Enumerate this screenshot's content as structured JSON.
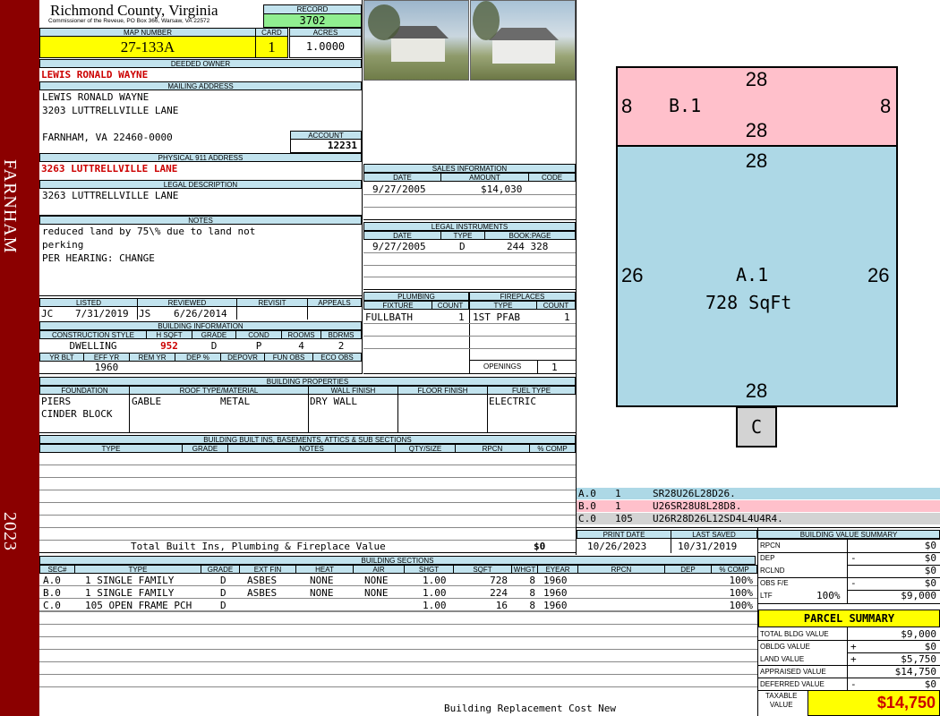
{
  "sidebar": {
    "town": "FARNHAM",
    "year": "2023"
  },
  "header": {
    "county": "Richmond County, Virginia",
    "commissioner": "Commissioner of the Reveue, PO Box 366, Warsaw, VA 22572",
    "record_label": "RECORD",
    "record": "3702",
    "map_label": "MAP NUMBER",
    "map_number": "27-133A",
    "card_label": "CARD",
    "card": "1",
    "acres_label": "ACRES",
    "acres": "1.0000"
  },
  "owner": {
    "deeded_label": "DEEDED OWNER",
    "deeded": "LEWIS RONALD WAYNE",
    "mailing_label": "MAILING ADDRESS",
    "mail1": "LEWIS RONALD WAYNE",
    "mail2": "3203 LUTTRELLVILLE LANE",
    "mail3": "FARNHAM, VA 22460-0000",
    "account_label": "ACCOUNT",
    "account": "12231",
    "physical_label": "PHYSICAL 911 ADDRESS",
    "physical": "3263 LUTTRELLVILLE LANE",
    "legal_label": "LEGAL DESCRIPTION",
    "legal": "3263 LUTTRELLVILLE LANE",
    "notes_label": "NOTES",
    "note1": "reduced land by 75\\% due to land not",
    "note2": "perking",
    "note3": "PER HEARING: CHANGE"
  },
  "review": {
    "listed_label": "LISTED",
    "reviewed_label": "REVIEWED",
    "revisit_label": "REVISIT",
    "appeals_label": "APPEALS",
    "listed_by": "JC",
    "listed_date": "7/31/2019",
    "reviewed_by": "JS",
    "reviewed_date": "6/26/2014"
  },
  "building_info": {
    "title": "BUILDING INFORMATION",
    "h_cs": "CONSTRUCTION STYLE",
    "h_hsqft": "H SQFT",
    "h_grade": "GRADE",
    "h_cond": "COND",
    "h_rooms": "ROOMS",
    "h_bdrms": "BDRMS",
    "cs": "DWELLING",
    "hsqft": "952",
    "grade": "D",
    "cond": "P",
    "rooms": "4",
    "bdrms": "2",
    "h_yrblt": "YR BLT",
    "h_effyr": "EFF YR",
    "h_remyr": "REM YR",
    "h_dep": "DEP %",
    "h_depovr": "DEPOVR",
    "h_funobs": "FUN OBS",
    "h_ecoobs": "ECO OBS",
    "effyr": "1960"
  },
  "sales": {
    "title": "SALES INFORMATION",
    "h_date": "DATE",
    "h_amount": "AMOUNT",
    "h_code": "CODE",
    "date": "9/27/2005",
    "amount": "$14,030"
  },
  "legal_inst": {
    "title": "LEGAL INSTRUMENTS",
    "h_date": "DATE",
    "h_type": "TYPE",
    "h_book": "BOOK:PAGE",
    "date": "9/27/2005",
    "type": "D",
    "book": "244 328"
  },
  "plumbing": {
    "title": "PLUMBING",
    "h_fixture": "FIXTURE",
    "h_count": "COUNT",
    "fixture": "FULLBATH",
    "count": "1"
  },
  "fireplaces": {
    "title": "FIREPLACES",
    "h_type": "TYPE",
    "h_count": "COUNT",
    "type": "1ST PFAB",
    "count": "1",
    "openings_label": "OPENINGS",
    "openings": "1"
  },
  "props": {
    "title": "BUILDING PROPERTIES",
    "h_found": "FOUNDATION",
    "h_roof": "ROOF TYPE/MATERIAL",
    "h_wall": "WALL FINISH",
    "h_floor": "FLOOR FINISH",
    "h_fuel": "FUEL TYPE",
    "found1": "PIERS",
    "found2": "CINDER BLOCK",
    "roof1": "GABLE",
    "roof2": "METAL",
    "wall": "DRY WALL",
    "fuel": "ELECTRIC"
  },
  "builtins": {
    "title": "BUILDING BUILT INS, BASEMENTS, ATTICS & SUB SECTIONS",
    "h_type": "TYPE",
    "h_grade": "GRADE",
    "h_notes": "NOTES",
    "h_qty": "QTY/SIZE",
    "h_rpcn": "RPCN",
    "h_comp": "% COMP",
    "total_label": "Total Built Ins, Plumbing & Fireplace Value",
    "total": "$0"
  },
  "sections": {
    "title": "BUILDING SECTIONS",
    "headers": [
      "SEC#",
      "TYPE",
      "GRADE",
      "EXT FIN",
      "HEAT",
      "AIR",
      "SHGT",
      "SQFT",
      "WHGT",
      "EYEAR",
      "RPCN",
      "DEP",
      "% COMP"
    ],
    "rows": [
      {
        "sec": "A.0",
        "type": "1 SINGLE FAMILY",
        "grade": "D",
        "ext": "ASBES",
        "heat": "NONE",
        "air": "NONE",
        "shgt": "1.00",
        "sqft": "728",
        "whgt": "8",
        "eyear": "1960",
        "comp": "100%"
      },
      {
        "sec": "B.0",
        "type": "1 SINGLE FAMILY",
        "grade": "D",
        "ext": "ASBES",
        "heat": "NONE",
        "air": "NONE",
        "shgt": "1.00",
        "sqft": "224",
        "whgt": "8",
        "eyear": "1960",
        "comp": "100%"
      },
      {
        "sec": "C.0",
        "type": "105 OPEN FRAME PCH",
        "grade": "D",
        "ext": "",
        "heat": "",
        "air": "",
        "shgt": "1.00",
        "sqft": "16",
        "whgt": "8",
        "eyear": "1960",
        "comp": "100%"
      }
    ],
    "footer": "Building Replacement Cost New"
  },
  "sketch": {
    "b_top": "28",
    "b_bottom": "28",
    "b_left": "8",
    "b_right": "8",
    "b_label": "B.1",
    "a_top": "28",
    "a_bottom": "28",
    "a_left": "26",
    "a_right": "26",
    "a_label": "A.1",
    "a_area": "728 SqFt",
    "c_label": "C",
    "colors": {
      "a": "#add8e6",
      "b": "#ffc0cb",
      "c": "#d3d3d3"
    }
  },
  "vectors": [
    {
      "sec": "A.0",
      "n": "1",
      "code": "SR28U26L28D26."
    },
    {
      "sec": "B.0",
      "n": "1",
      "code": "U26SR28U8L28D8."
    },
    {
      "sec": "C.0",
      "n": "105",
      "code": "U26R28D26L12SD4L4U4R4."
    }
  ],
  "dates": {
    "print_label": "PRINT DATE",
    "print": "10/26/2023",
    "saved_label": "LAST SAVED",
    "saved": "10/31/2019"
  },
  "value_summary": {
    "title": "BUILDING VALUE SUMMARY",
    "rpcn_label": "RPCN",
    "rpcn": "$0",
    "dep_label": "DEP",
    "dep_sign": "-",
    "dep": "$0",
    "rclnd_label": "RCLND",
    "rclnd": "$0",
    "obs_label": "OBS F/E",
    "obs_sign": "-",
    "obs": "$0",
    "ltf_label": "LTF",
    "ltf_pct": "100%",
    "ltf": "$9,000"
  },
  "parcel": {
    "title": "PARCEL SUMMARY",
    "total_label": "TOTAL BLDG VALUE",
    "total": "$9,000",
    "obldg_label": "OBLDG VALUE",
    "obldg_sign": "+",
    "obldg": "$0",
    "land_label": "LAND VALUE",
    "land_sign": "+",
    "land": "$5,750",
    "appr_label": "APPRAISED VALUE",
    "appr": "$14,750",
    "def_label": "DEFERRED VALUE",
    "def_sign": "-",
    "def": "$0",
    "taxable_label1": "TAXABLE",
    "taxable_label2": "VALUE",
    "taxable": "$14,750"
  }
}
